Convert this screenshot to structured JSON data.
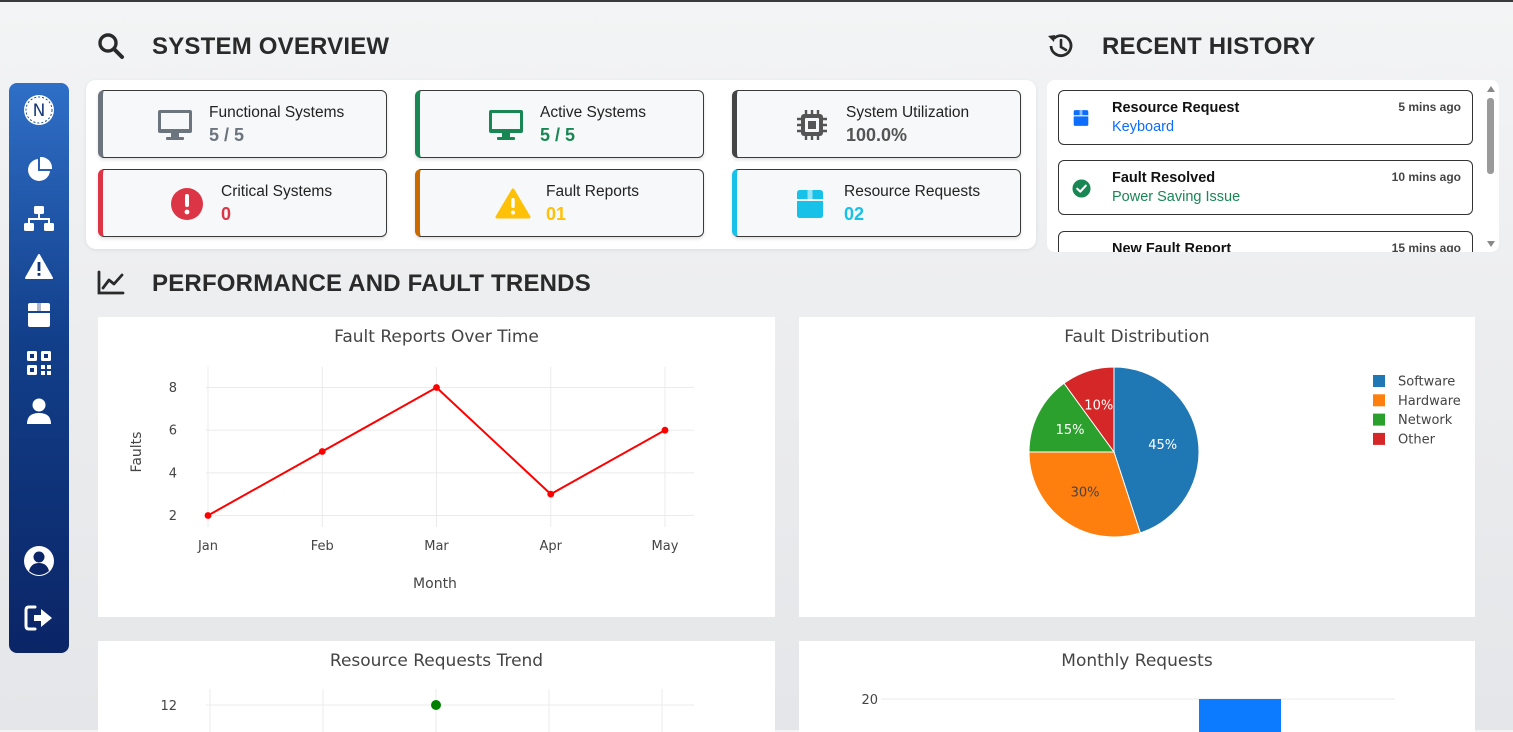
{
  "sidebar": {
    "logo_letter": "N",
    "items": [
      {
        "icon": "chart-pie-icon"
      },
      {
        "icon": "network-icon"
      },
      {
        "icon": "warning-icon"
      },
      {
        "icon": "box-icon"
      },
      {
        "icon": "qrcode-icon"
      },
      {
        "icon": "user-icon"
      }
    ],
    "bottom": [
      {
        "icon": "user-circle-icon"
      },
      {
        "icon": "logout-icon"
      }
    ]
  },
  "overview": {
    "title": "SYSTEM OVERVIEW",
    "cards": [
      {
        "label": "Functional Systems",
        "value": "5 / 5",
        "icon": "desktop-icon",
        "color": "#6c757d"
      },
      {
        "label": "Active Systems",
        "value": "5 / 5",
        "icon": "desktop-icon",
        "color": "#198754"
      },
      {
        "label": "System Utilization",
        "value": "100.0%",
        "icon": "cpu-icon",
        "color": "#555555"
      },
      {
        "label": "Critical Systems",
        "value": "0",
        "icon": "exclamation-circle-icon",
        "color": "#dc3545"
      },
      {
        "label": "Fault Reports",
        "value": "01",
        "icon": "warning-icon",
        "color": "#ffc107"
      },
      {
        "label": "Resource Requests",
        "value": "02",
        "icon": "box-icon",
        "color": "#17c1e8"
      }
    ]
  },
  "history": {
    "title": "RECENT HISTORY",
    "items": [
      {
        "title": "Resource Request",
        "subtitle": "Keyboard",
        "time": "5 mins ago",
        "icon": "box-icon",
        "color": "#0d6efd"
      },
      {
        "title": "Fault Resolved",
        "subtitle": "Power Saving Issue",
        "time": "10 mins ago",
        "icon": "check-circle-icon",
        "color": "#198754"
      },
      {
        "title": "New Fault Report",
        "subtitle": "",
        "time": "15 mins ago",
        "icon": "warning-icon",
        "color": "#ffc107"
      }
    ]
  },
  "trends": {
    "title": "PERFORMANCE AND FAULT TRENDS"
  },
  "colors": {
    "accent_blue": "#0d6efd",
    "success": "#198754",
    "danger": "#dc3545",
    "warning": "#ffc107",
    "info": "#17c1e8"
  },
  "chart_data": [
    {
      "type": "line",
      "title": "Fault Reports Over Time",
      "xlabel": "Month",
      "ylabel": "Faults",
      "categories": [
        "Jan",
        "Feb",
        "Mar",
        "Apr",
        "May"
      ],
      "values": [
        2,
        5,
        8,
        3,
        6
      ],
      "yticks": [
        2,
        4,
        6,
        8
      ],
      "ylim": [
        1.6,
        8.4
      ],
      "color": "#ff0000",
      "grid": true
    },
    {
      "type": "pie",
      "title": "Fault Distribution",
      "legend_position": "top-right",
      "slices": [
        {
          "name": "Software",
          "value": 45,
          "label": "45%",
          "color": "#1f77b4"
        },
        {
          "name": "Hardware",
          "value": 30,
          "label": "30%",
          "color": "#ff7f0e"
        },
        {
          "name": "Network",
          "value": 15,
          "label": "15%",
          "color": "#2ca02c"
        },
        {
          "name": "Other",
          "value": 10,
          "label": "10%",
          "color": "#d62728"
        }
      ]
    },
    {
      "type": "scatter",
      "title": "Resource Requests Trend",
      "visible_ytick": 12,
      "point": {
        "x": "Mar",
        "y": 12
      },
      "color": "#008000"
    },
    {
      "type": "bar",
      "title": "Monthly Requests",
      "visible_ytick": 20,
      "color": "#0d7bff"
    }
  ]
}
